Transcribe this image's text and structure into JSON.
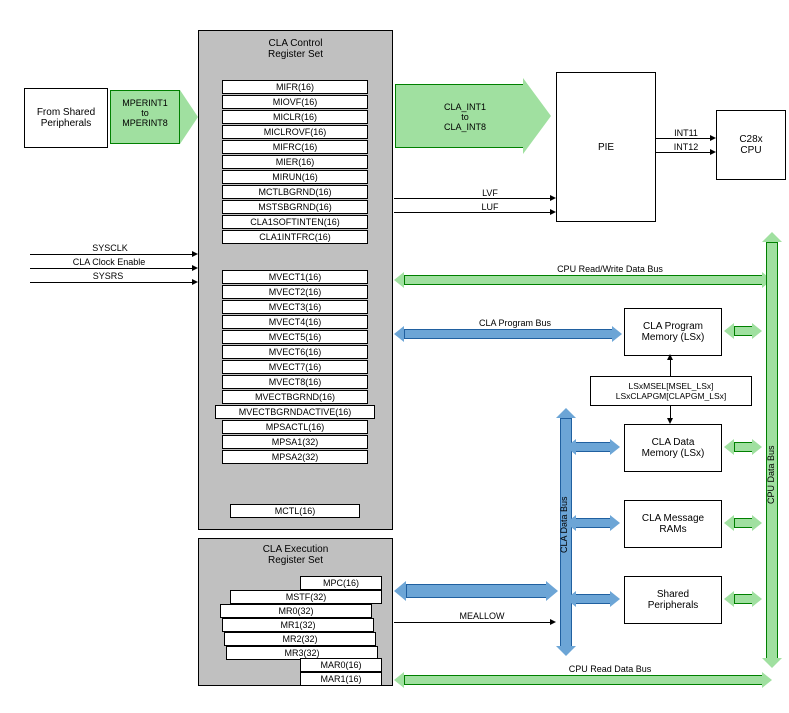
{
  "leftbox": {
    "title": "From Shared\nPeripherals"
  },
  "arrow1": {
    "text": "MPERINT1\nto\nMPERINT8"
  },
  "arrow2": {
    "text": "CLA_INT1\nto\nCLA_INT8"
  },
  "controlset": {
    "title": "CLA Control\nRegister Set",
    "regs1": [
      "MIFR(16)",
      "MIOVF(16)",
      "MICLR(16)",
      "MICLROVF(16)",
      "MIFRC(16)",
      "MIER(16)",
      "MIRUN(16)",
      "MCTLBGRND(16)",
      "MSTSBGRND(16)",
      "CLA1SOFTINTEN(16)",
      "CLA1INTFRC(16)"
    ],
    "regs2": [
      "MVECT1(16)",
      "MVECT2(16)",
      "MVECT3(16)",
      "MVECT4(16)",
      "MVECT5(16)",
      "MVECT6(16)",
      "MVECT7(16)",
      "MVECT8(16)",
      "MVECTBGRND(16)",
      "MVECTBGRNDACTIVE(16)",
      "MPSACTL(16)",
      "MPSA1(32)",
      "MPSA2(32)"
    ],
    "mctl": "MCTL(16)"
  },
  "execset": {
    "title": "CLA Execution\nRegister Set",
    "mpc": "MPC(16)",
    "mstf": "MSTF(32)",
    "mr": [
      "MR0(32)",
      "MR1(32)",
      "MR2(32)",
      "MR3(32)"
    ],
    "mar": [
      "MAR0(16)",
      "MAR1(16)"
    ]
  },
  "signals": {
    "sysclk": "SYSCLK",
    "claclk": "CLA Clock Enable",
    "sysrs": "SYSRS",
    "lvf": "LVF",
    "luf": "LUF",
    "int11": "INT11",
    "int12": "INT12",
    "meallow": "MEALLOW"
  },
  "pie": "PIE",
  "cpu": "C28x\nCPU",
  "progmem": "CLA Program\nMemory (LSx)",
  "msel": "LSxMSEL[MSEL_LSx]\nLSxCLAPGM[CLAPGM_LSx]",
  "datamem": "CLA Data\nMemory (LSx)",
  "msgram": "CLA Message\nRAMs",
  "shared": "Shared\nPeripherals",
  "buses": {
    "rwdata": "CPU Read/Write Data Bus",
    "prog": "CLA Program Bus",
    "cladata": "CLA Data Bus",
    "cpudata": "CPU Data Bus",
    "readdata": "CPU Read Data Bus"
  }
}
